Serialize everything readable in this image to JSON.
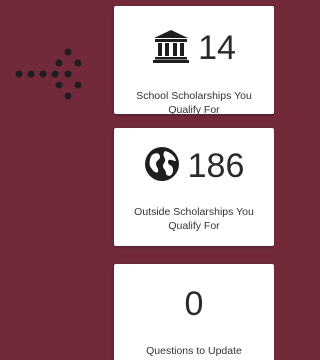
{
  "colors": {
    "background": "#722a3a",
    "card": "#ffffff",
    "text": "#222222"
  },
  "decoration": {
    "icon": "dotted-arrow-right-icon"
  },
  "cards": [
    {
      "icon": "institution-icon",
      "value": "14",
      "label": "School Scholarships You Qualify For"
    },
    {
      "icon": "globe-icon",
      "value": "186",
      "label": "Outside Scholarships You Qualify For"
    },
    {
      "icon": "",
      "value": "0",
      "label": "Questions to Update"
    }
  ]
}
